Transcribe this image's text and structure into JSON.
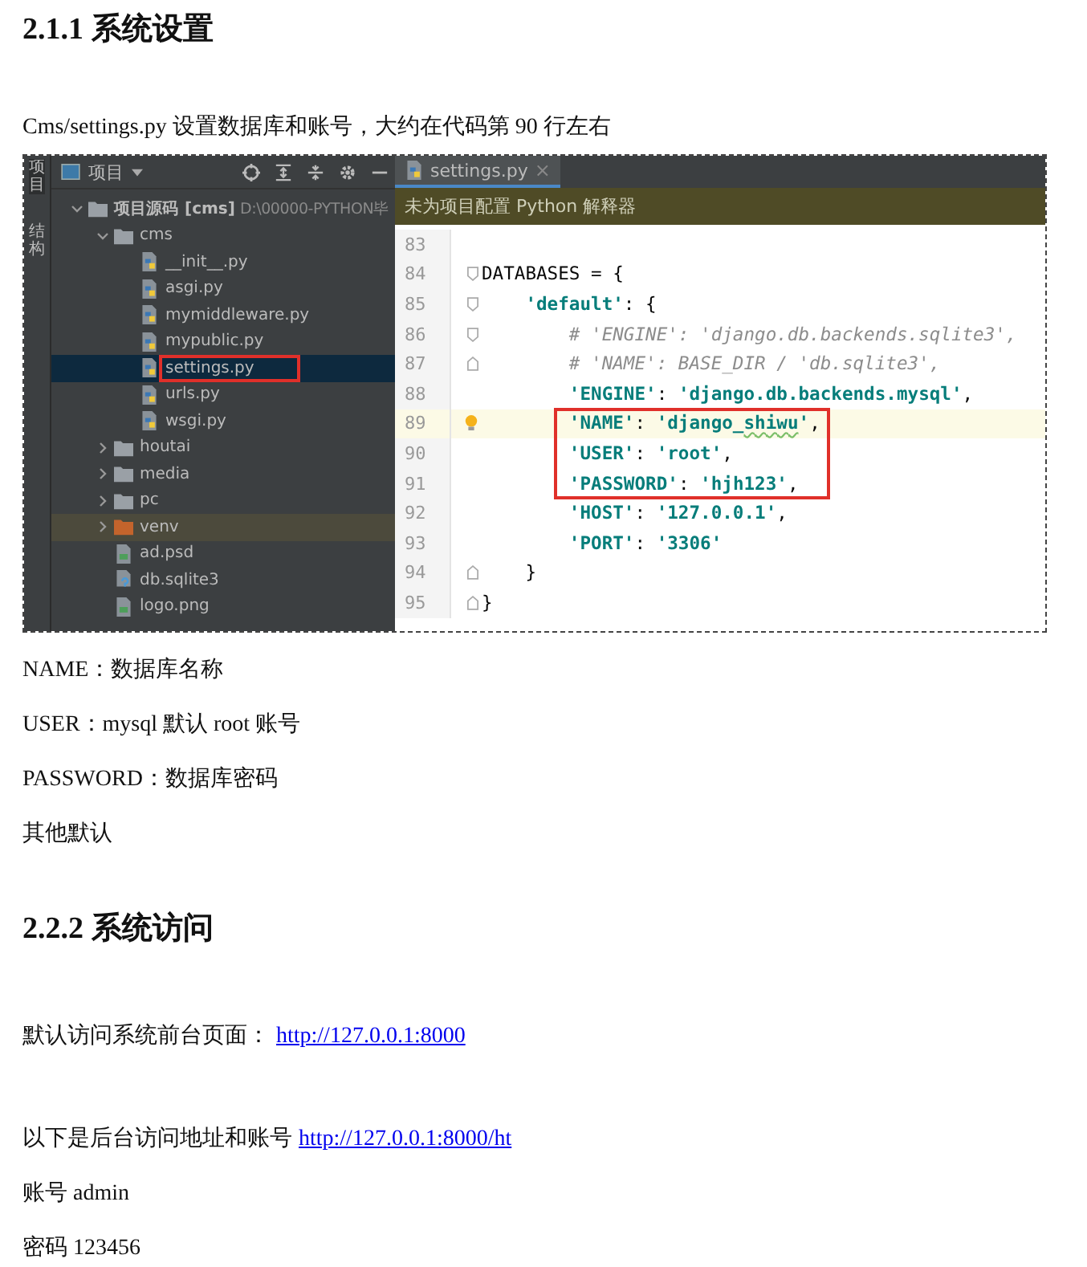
{
  "blocks": [
    {
      "kind": "heading",
      "text": "2.1.1 系统设置"
    },
    {
      "kind": "para",
      "text": "Cms/settings.py  设置数据库和账号，大约在代码第 90 行左右"
    },
    {
      "kind": "ide",
      "side_tabs": [
        "项目",
        "结构"
      ],
      "panel": {
        "title": "项目"
      },
      "tree": [
        {
          "kind": "root",
          "name": "项目源码",
          "tag": "[cms]",
          "path": "D:\\00000-PYTHON毕",
          "expanded": true,
          "selected": false,
          "children": [
            {
              "kind": "folder",
              "name": "cms",
              "expanded": true,
              "selected": false,
              "children": [
                {
                  "kind": "py",
                  "name": "__init__.py",
                  "selected": false
                },
                {
                  "kind": "py",
                  "name": "asgi.py",
                  "selected": false
                },
                {
                  "kind": "py",
                  "name": "mymiddleware.py",
                  "selected": false
                },
                {
                  "kind": "py",
                  "name": "mypublic.py",
                  "selected": false
                },
                {
                  "kind": "py",
                  "name": "settings.py",
                  "selected": true,
                  "boxed": true
                },
                {
                  "kind": "py",
                  "name": "urls.py",
                  "selected": false
                },
                {
                  "kind": "py",
                  "name": "wsgi.py",
                  "selected": false
                }
              ]
            },
            {
              "kind": "folder",
              "name": "houtai",
              "expanded": false,
              "selected": false
            },
            {
              "kind": "folder",
              "name": "media",
              "expanded": false,
              "selected": false
            },
            {
              "kind": "folder",
              "name": "pc",
              "expanded": false,
              "selected": false
            },
            {
              "kind": "excluded",
              "name": "venv",
              "expanded": false,
              "selected": false
            },
            {
              "kind": "file",
              "name": "ad.psd",
              "selected": false
            },
            {
              "kind": "db",
              "name": "db.sqlite3",
              "selected": false
            },
            {
              "kind": "file",
              "name": "logo.png",
              "selected": false
            }
          ]
        }
      ],
      "tab": {
        "label": "settings.py",
        "close": "×"
      },
      "banner": "未为项目配置 Python 解释器",
      "lines": [
        {
          "no": "83"
        },
        {
          "no": "84",
          "fold_start": true,
          "tokens": [
            {
              "t": "DATABASES = {",
              "kind": "plain"
            }
          ]
        },
        {
          "no": "85",
          "fold_start": true,
          "tokens": [
            {
              "t": "    'default'",
              "kind": "string"
            },
            {
              "t": ": {",
              "kind": "plain"
            }
          ]
        },
        {
          "no": "86",
          "fold_start": true,
          "tokens": [
            {
              "t": "        # 'ENGINE': 'django.db.backends.sqlite3',",
              "kind": "comment"
            }
          ]
        },
        {
          "no": "87",
          "fold_end": true,
          "tokens": [
            {
              "t": "        # 'NAME': BASE_DIR / 'db.sqlite3',",
              "kind": "comment"
            }
          ]
        },
        {
          "no": "88",
          "tokens": [
            {
              "t": "        'ENGINE'",
              "kind": "string"
            },
            {
              "t": ": ",
              "kind": "plain"
            },
            {
              "t": "'django.db.backends.mysql'",
              "kind": "string"
            },
            {
              "t": ",",
              "kind": "plain"
            }
          ]
        },
        {
          "no": "89",
          "current": true,
          "bulb": true,
          "boxed": true,
          "tokens": [
            {
              "t": "        'NAME'",
              "kind": "string"
            },
            {
              "t": ": ",
              "kind": "plain"
            },
            {
              "t": "'django_",
              "kind": "string"
            },
            {
              "t": "shiwu",
              "kind": "string",
              "typo": true
            },
            {
              "t": "'",
              "kind": "string"
            },
            {
              "t": ",",
              "kind": "plain"
            }
          ]
        },
        {
          "no": "90",
          "boxed": true,
          "tokens": [
            {
              "t": "        'USER'",
              "kind": "string"
            },
            {
              "t": ": ",
              "kind": "plain"
            },
            {
              "t": "'root'",
              "kind": "string"
            },
            {
              "t": ",",
              "kind": "plain"
            }
          ]
        },
        {
          "no": "91",
          "boxed": true,
          "tokens": [
            {
              "t": "        'PASSWORD'",
              "kind": "string"
            },
            {
              "t": ": ",
              "kind": "plain"
            },
            {
              "t": "'hjh123'",
              "kind": "string"
            },
            {
              "t": ",",
              "kind": "plain"
            }
          ]
        },
        {
          "no": "92",
          "tokens": [
            {
              "t": "        'HOST'",
              "kind": "string"
            },
            {
              "t": ": ",
              "kind": "plain"
            },
            {
              "t": "'127.0.0.1'",
              "kind": "string"
            },
            {
              "t": ",",
              "kind": "plain"
            }
          ]
        },
        {
          "no": "93",
          "tokens": [
            {
              "t": "        'PORT'",
              "kind": "string"
            },
            {
              "t": ": ",
              "kind": "plain"
            },
            {
              "t": "'3306'",
              "kind": "string"
            }
          ]
        },
        {
          "no": "94",
          "fold_end": true,
          "tokens": [
            {
              "t": "    }",
              "kind": "plain"
            }
          ]
        },
        {
          "no": "95",
          "fold_end": true,
          "tokens": [
            {
              "t": "}",
              "kind": "plain"
            }
          ]
        }
      ]
    },
    {
      "kind": "para",
      "text": "NAME：数据库名称"
    },
    {
      "kind": "para",
      "text": "USER：mysql 默认 root 账号"
    },
    {
      "kind": "para",
      "text": "PASSWORD：数据库密码"
    },
    {
      "kind": "para",
      "text": "其他默认"
    },
    {
      "kind": "heading",
      "text": "2.2.2 系统访问"
    },
    {
      "kind": "link_para",
      "text": "默认访问系统前台页面：",
      "link": "http://127.0.0.1:8000"
    },
    {
      "kind": "link_para",
      "text": "以下是后台访问地址和账号",
      "link": "http://127.0.0.1:8000/ht"
    },
    {
      "kind": "para",
      "text": "账号 admin"
    },
    {
      "kind": "para",
      "text": "密码 123456"
    }
  ]
}
